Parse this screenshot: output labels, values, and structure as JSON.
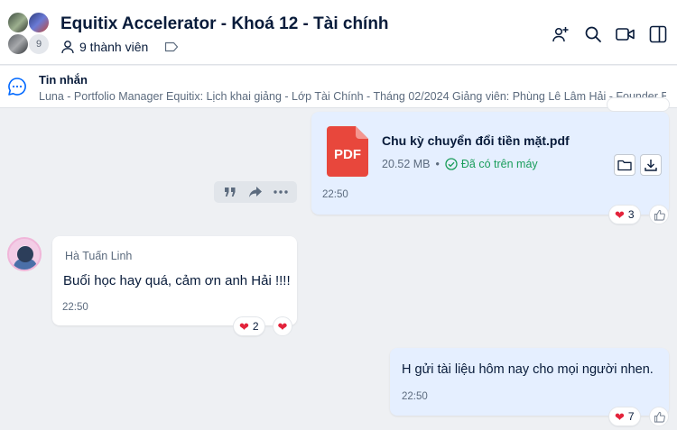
{
  "header": {
    "title": "Equitix Accelerator - Khoá 12 - Tài chính",
    "member_avatar_count": "9",
    "members_label": "9 thành viên"
  },
  "pinned": {
    "title": "Tin nhắn",
    "text": "Luna - Portfolio Manager Equitix: Lịch khai giảng - Lớp Tài Chính - Tháng 02/2024  Giảng viên: Phùng Lê Lâm Hải - Founder Equitix"
  },
  "messages": {
    "file": {
      "icon_label": "PDF",
      "name": "Chu kỳ chuyển đổi tiền mặt.pdf",
      "size": "20.52 MB",
      "dot": "•",
      "status": "Đã có trên máy",
      "time": "22:50",
      "reaction_count": "3"
    },
    "received": {
      "sender": "Hà Tuấn Linh",
      "text": "Buổi học hay quá, cảm ơn anh Hải !!!!",
      "time": "22:50",
      "reaction_count": "2"
    },
    "sent2": {
      "text": "H gửi tài liệu hôm nay cho mọi người nhen.",
      "time": "22:50",
      "reaction_count": "7"
    }
  },
  "colors": {
    "accent": "#0068ff",
    "sent_bubble": "#e5efff",
    "heart": "#e3233b",
    "status_ok": "#1a9d5a",
    "pdf_red": "#e8473c"
  },
  "icons": {
    "add_member": "add-member-icon",
    "search": "search-icon",
    "video_call": "video-call-icon",
    "sidebar_toggle": "sidebar-toggle-icon",
    "chat": "chat-bubble-icon",
    "quote": "quote-icon",
    "forward": "forward-icon",
    "more": "more-icon",
    "folder": "folder-icon",
    "download": "download-icon",
    "like": "thumbs-up-icon"
  }
}
